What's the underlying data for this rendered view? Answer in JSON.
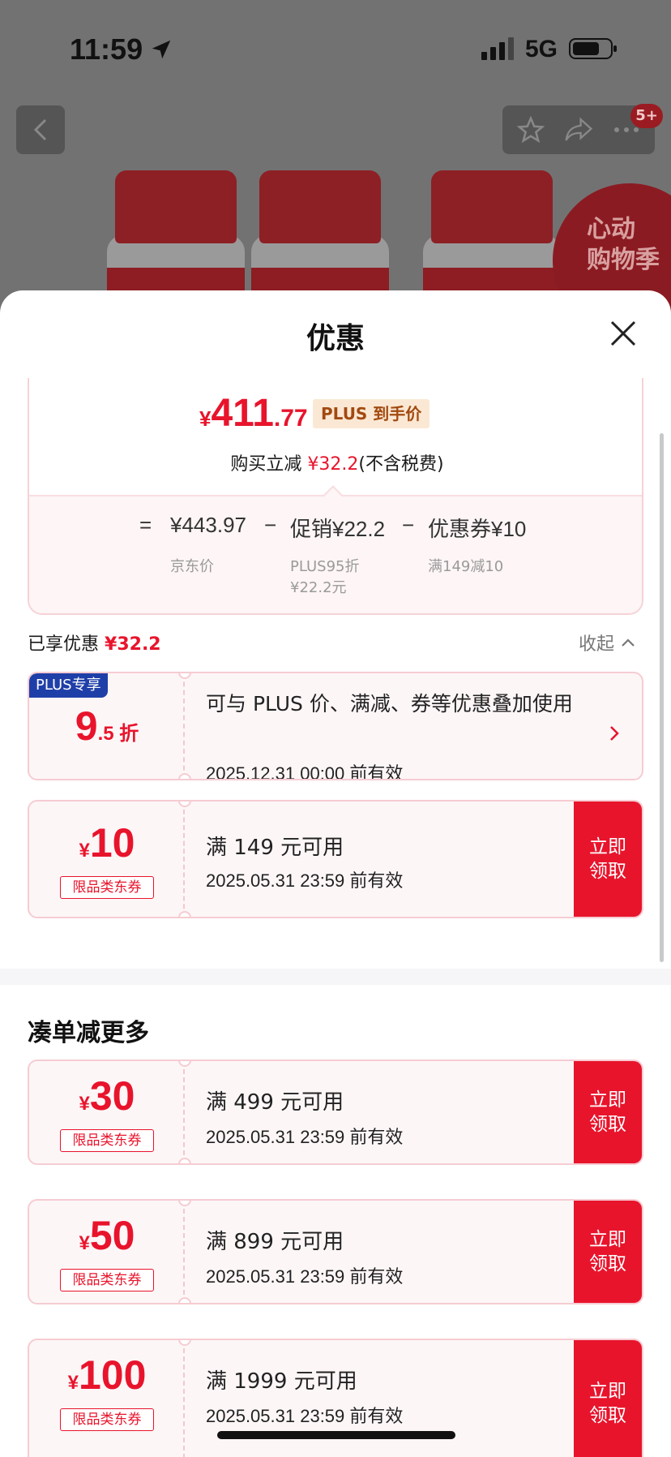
{
  "status_bar": {
    "time": "11:59",
    "network": "5G"
  },
  "background": {
    "cart_badge": "5+",
    "promo_text": [
      "心动",
      "购物季"
    ]
  },
  "sheet": {
    "title": "优惠"
  },
  "price_card": {
    "currency": "¥",
    "price_int": "411",
    "price_dec": ".77",
    "plus_tag": "PLUS 到手价",
    "reduce_prefix": "购买立减",
    "reduce_amount": "¥32.2",
    "reduce_suffix": "(不含税费)",
    "calc": {
      "equals": "=",
      "jd_price": "¥443.97",
      "minus1": "−",
      "promo": "促销¥22.2",
      "minus2": "−",
      "coupon": "优惠券¥10",
      "jd_price_label": "京东价",
      "promo_sub1": "PLUS95折",
      "promo_sub2": "¥22.2元",
      "coupon_sub": "满149减10"
    }
  },
  "enjoyed": {
    "label": "已享优惠",
    "amount": "¥32.2",
    "collapse": "收起"
  },
  "plus_coupon": {
    "corner": "PLUS专享",
    "big": "9",
    "small": ".5 折",
    "desc": "可与 PLUS 价、满减、券等优惠叠加使用",
    "validity": "2025.12.31 00:00 前有效"
  },
  "coupons": [
    {
      "yen": "¥",
      "amount": "10",
      "type": "限品类东券",
      "condition": "满 149 元可用",
      "validity": "2025.05.31 23:59 前有效",
      "claim": "立即领取"
    }
  ],
  "more_section": {
    "title": "凑单减更多",
    "coupons": [
      {
        "yen": "¥",
        "amount": "30",
        "type": "限品类东券",
        "condition": "满 499 元可用",
        "validity": "2025.05.31 23:59 前有效",
        "claim": "立即领取"
      },
      {
        "yen": "¥",
        "amount": "50",
        "type": "限品类东券",
        "condition": "满 899 元可用",
        "validity": "2025.05.31 23:59 前有效",
        "claim": "立即领取"
      },
      {
        "yen": "¥",
        "amount": "100",
        "type": "限品类东券",
        "condition": "满 1999 元可用",
        "validity": "2025.05.31 23:59 前有效",
        "claim": "立即领取"
      }
    ]
  },
  "colors": {
    "accent_red": "#e8142c",
    "plus_blue": "#1f3fa8",
    "plus_tag_bg": "#fbe8d4"
  }
}
